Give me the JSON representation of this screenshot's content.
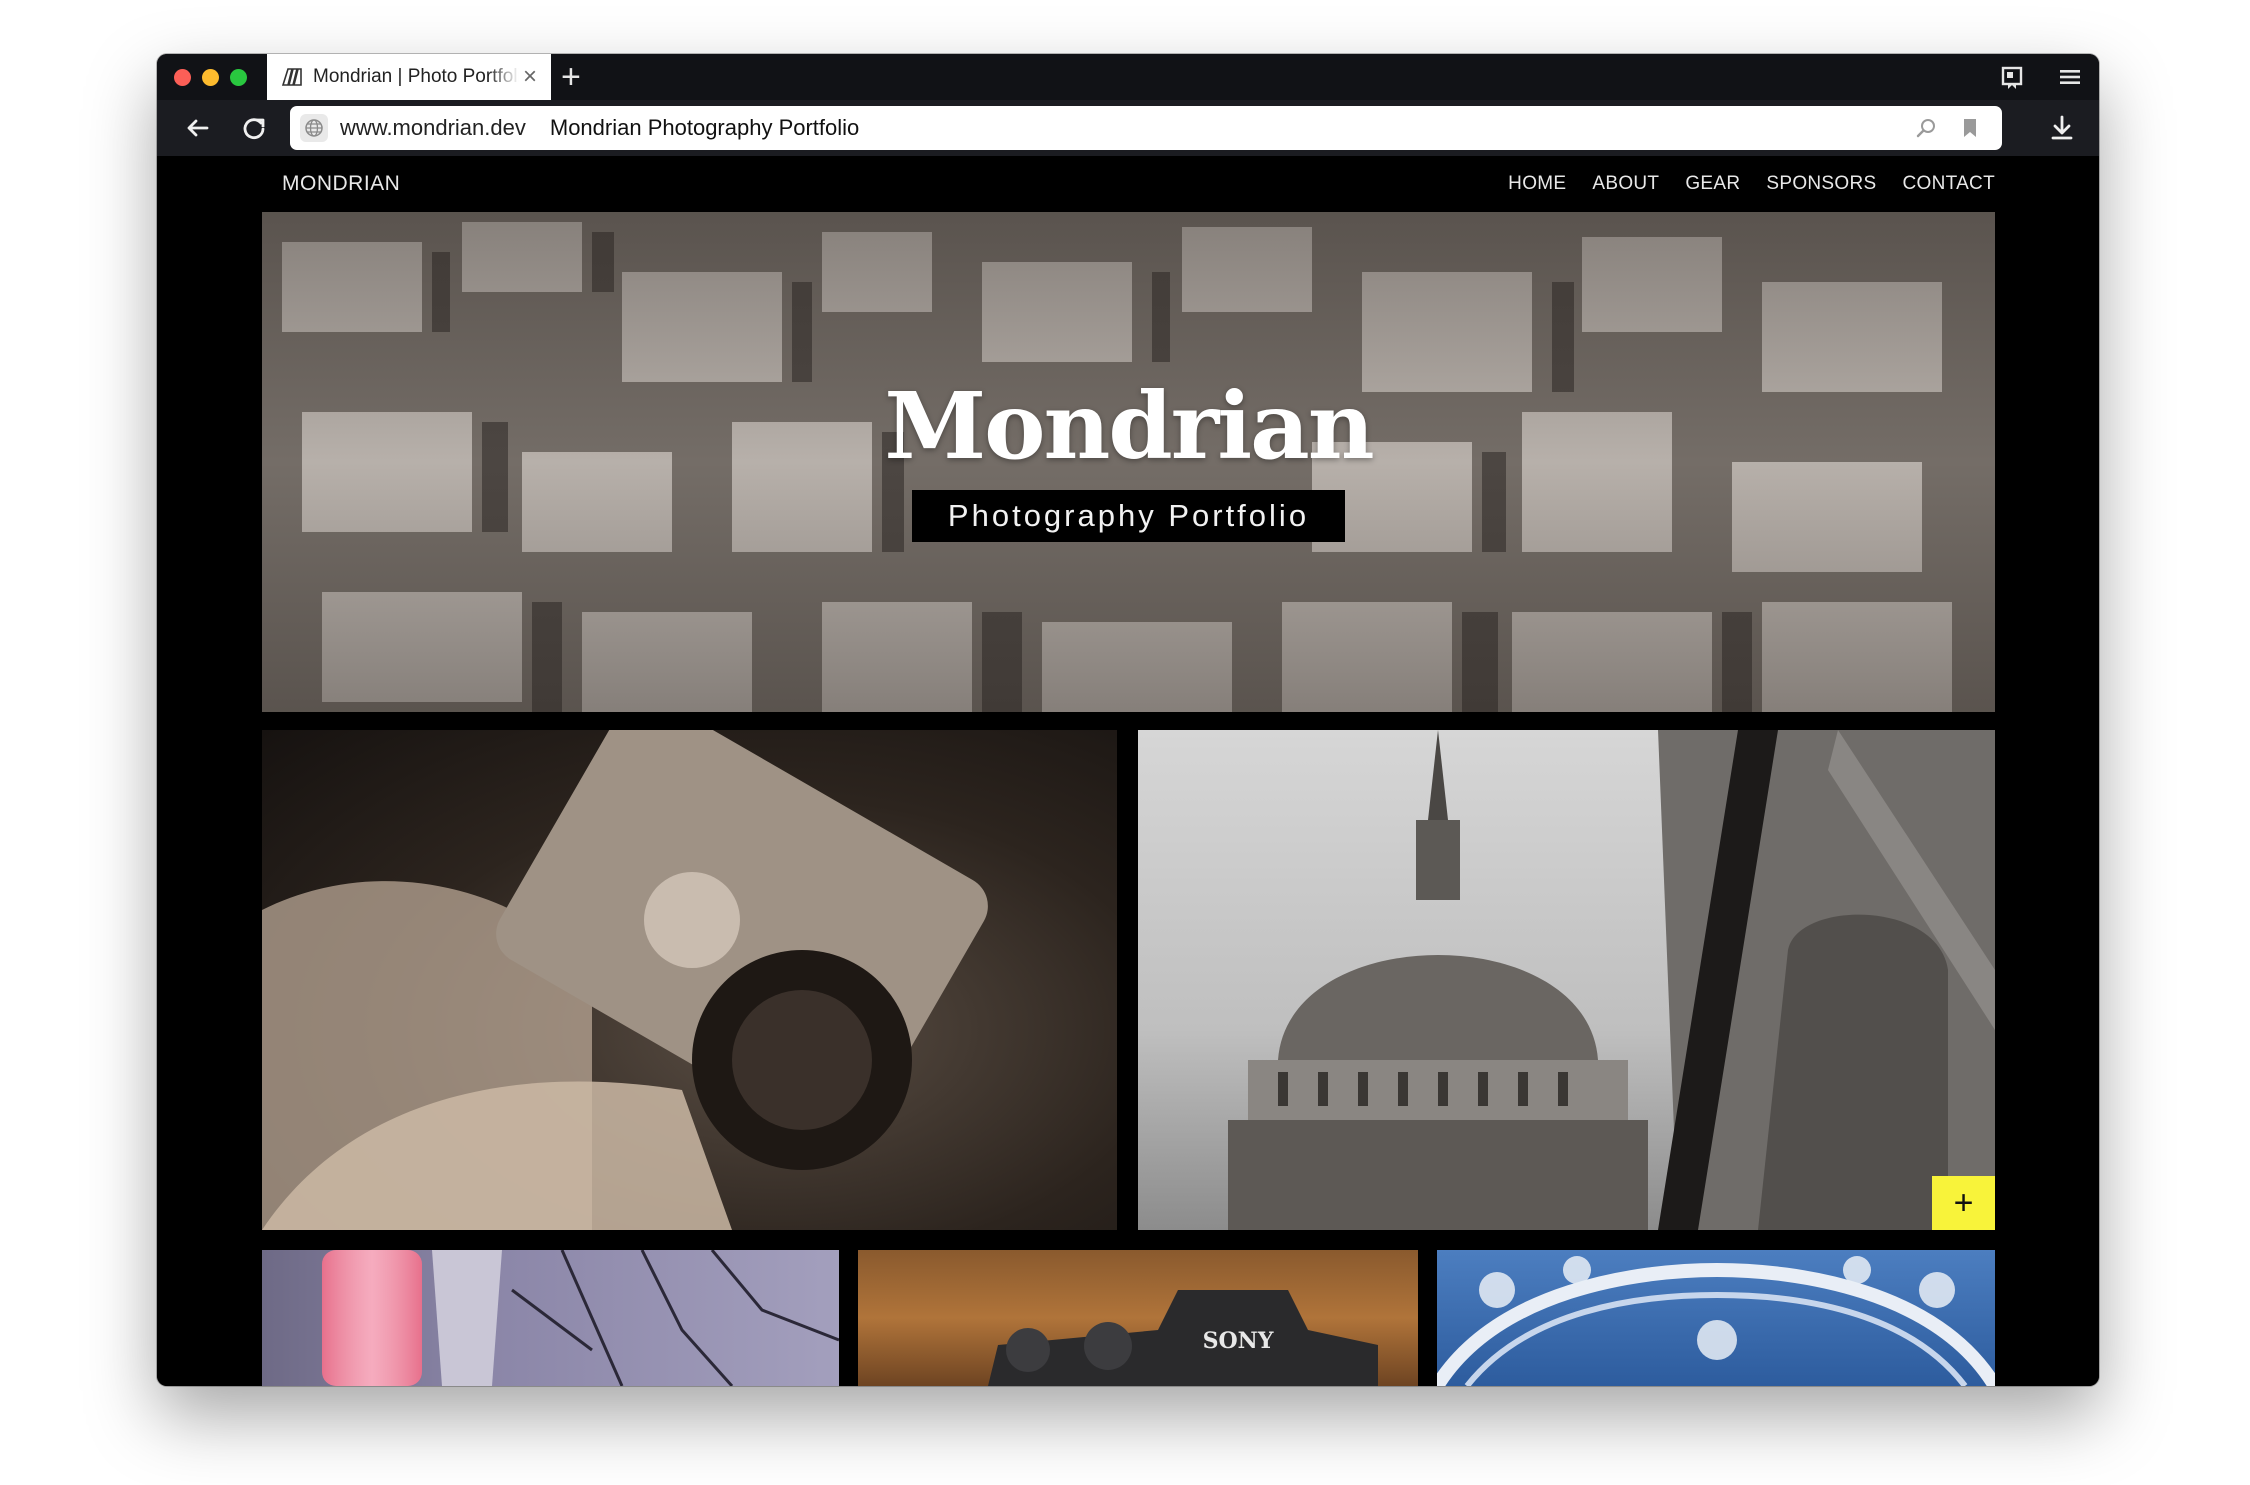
{
  "browser": {
    "tab": {
      "title": "Mondrian | Photo Portfolio",
      "favicon": "mondrian-favicon-icon",
      "close_glyph": "×"
    },
    "new_tab_glyph": "+",
    "address_bar": {
      "host": "www.mondrian.dev",
      "page_title": "Mondrian Photography Portfolio"
    },
    "icons": {
      "back": "back-arrow-icon",
      "reload": "reload-icon",
      "site_info": "globe-icon",
      "search": "magnifier-icon",
      "bookmark": "bookmark-icon",
      "download": "download-icon",
      "sidebar": "sidebar-icon",
      "menu": "hamburger-menu-icon"
    },
    "colors": {
      "traffic_red": "#fc5f57",
      "traffic_yellow": "#fdbb2e",
      "traffic_green": "#29c73f",
      "chrome_dark": "#111216"
    }
  },
  "site": {
    "brand": "MONDRIAN",
    "nav": [
      {
        "label": "HOME"
      },
      {
        "label": "ABOUT"
      },
      {
        "label": "GEAR"
      },
      {
        "label": "SPONSORS"
      },
      {
        "label": "CONTACT"
      }
    ],
    "hero": {
      "title": "Mondrian",
      "subtitle": "Photography Portfolio"
    },
    "gallery": {
      "expand_glyph": "+",
      "accent_color": "#f8f33a",
      "tiles": [
        {
          "subject": "camera-in-hands-photo"
        },
        {
          "subject": "cathedral-dome-photo"
        },
        {
          "subject": "lantern-blossom-photo"
        },
        {
          "subject": "sony-camera-photo",
          "label": "SONY"
        },
        {
          "subject": "ornate-tiles-photo"
        }
      ]
    }
  }
}
